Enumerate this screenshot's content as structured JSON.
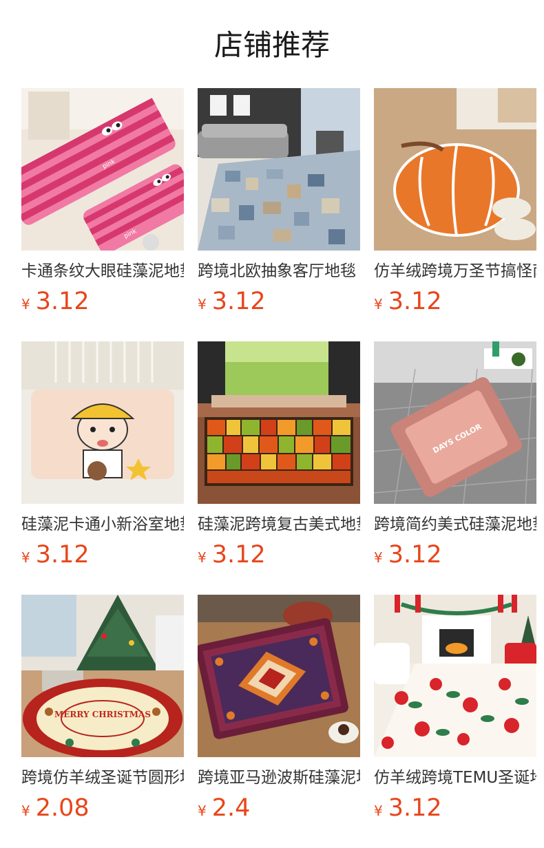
{
  "page": {
    "title": "店铺推荐"
  },
  "products": [
    {
      "name": "卡通条纹大眼硅藻泥地垫",
      "currency": "¥",
      "price": "3.12",
      "image": "pink-striped-cartoon-eye-mat",
      "colors": {
        "primary": "#d6386e",
        "secondary": "#f07aa3",
        "bg": "#efe7dc"
      },
      "image_text": "pink"
    },
    {
      "name": "跨境北欧抽象客厅地毯",
      "currency": "¥",
      "price": "3.12",
      "image": "abstract-grid-living-room-rug",
      "colors": {
        "primary": "#8fa5b8",
        "secondary": "#d8c9a8",
        "bg": "#e7e3dc"
      }
    },
    {
      "name": "仿羊绒跨境万圣节搞怪南瓜地垫",
      "currency": "¥",
      "price": "3.12",
      "image": "pumpkin-shaped-mat",
      "colors": {
        "primary": "#e9772a",
        "secondary": "#ffffff",
        "bg": "#c9a883"
      }
    },
    {
      "name": "硅藻泥卡通小新浴室地垫",
      "currency": "¥",
      "price": "3.12",
      "image": "crayon-shin-chan-bath-mat",
      "colors": {
        "primary": "#f6dccb",
        "secondary": "#f2c230",
        "bg": "#efece6"
      }
    },
    {
      "name": "硅藻泥跨境复古美式地垫",
      "currency": "¥",
      "price": "3.12",
      "image": "stained-glass-doorway-mat",
      "colors": {
        "primary": "#e0591a",
        "secondary": "#8fb52e",
        "bg": "#a66a4a"
      }
    },
    {
      "name": "跨境简约美式硅藻泥地垫",
      "currency": "¥",
      "price": "3.12",
      "image": "days-color-pink-mat",
      "colors": {
        "primary": "#c98378",
        "secondary": "#e9a99c",
        "bg": "#8c8c8c"
      },
      "image_text": "DAYS COLOR"
    },
    {
      "name": "跨境仿羊绒圣诞节圆形地毯",
      "currency": "¥",
      "price": "2.08",
      "image": "round-merry-christmas-rug",
      "colors": {
        "primary": "#b7231d",
        "secondary": "#f6ecc8",
        "bg": "#c8a07a"
      },
      "image_text": "MERRY CHRISTMAS"
    },
    {
      "name": "跨境亚马逊波斯硅藻泥地垫",
      "currency": "¥",
      "price": "2.4",
      "image": "persian-pattern-kitchen-mat",
      "colors": {
        "primary": "#8a2a4a",
        "secondary": "#e07a2a",
        "bg": "#a77a4f"
      }
    },
    {
      "name": "仿羊绒跨境TEMU圣诞地毯",
      "currency": "¥",
      "price": "3.12",
      "image": "poinsettia-christmas-rug",
      "colors": {
        "primary": "#d8242a",
        "secondary": "#2e7d4a",
        "bg": "#f4efe6"
      }
    }
  ]
}
